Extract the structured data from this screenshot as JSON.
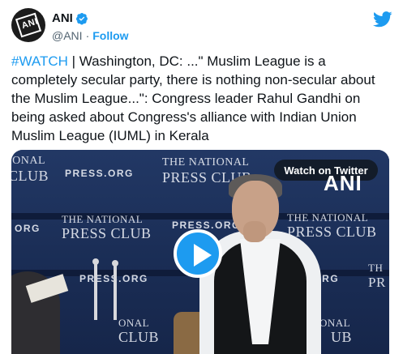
{
  "account": {
    "display_name": "ANI",
    "handle": "@ANI",
    "separator": "·",
    "follow_label": "Follow",
    "avatar_text": "ANI"
  },
  "tweet": {
    "hashtag": "#WATCH",
    "body": " | Washington, DC: ...\" Muslim League is a completely secular party, there is nothing non-secular about the Muslim League...\": Congress leader Rahul Gandhi on being asked about Congress's alliance with Indian Union Muslim League (IUML) in Kerala"
  },
  "media": {
    "watch_label": "Watch on Twitter",
    "logo_text": "ANI",
    "backdrop_texts": {
      "left_top_1": "IONAL",
      "left_top_2": "CLUB",
      "press_org_1": "PRESS.ORG",
      "press_club_top_1": "THE NATIONAL",
      "press_club_top_2": "PRESS CLUB",
      "left_mid": "ORG",
      "press_club_mid_1": "THE NATIONAL",
      "press_club_mid_2": "PRESS CLUB",
      "press_org_mid": "PRESS.ORG",
      "press_club_right_1": "THE NATIONAL",
      "press_club_right_2": "PRESS CLUB",
      "press_org_lower_left": "PRESS.ORG",
      "press_org_lower_right": "S.ORG",
      "right_lower_1": "TH",
      "right_lower_2": "PR",
      "bottom_1": "ONAL",
      "bottom_2": "CLUB",
      "bottom_right_1": "ONAL",
      "bottom_right_2": "UB"
    }
  },
  "colors": {
    "accent": "#1d9bf0",
    "text": "#0f1419",
    "secondary": "#536471"
  },
  "icons": {
    "verified": "verified-badge-icon",
    "brand": "twitter-bird-icon",
    "play": "play-icon"
  }
}
